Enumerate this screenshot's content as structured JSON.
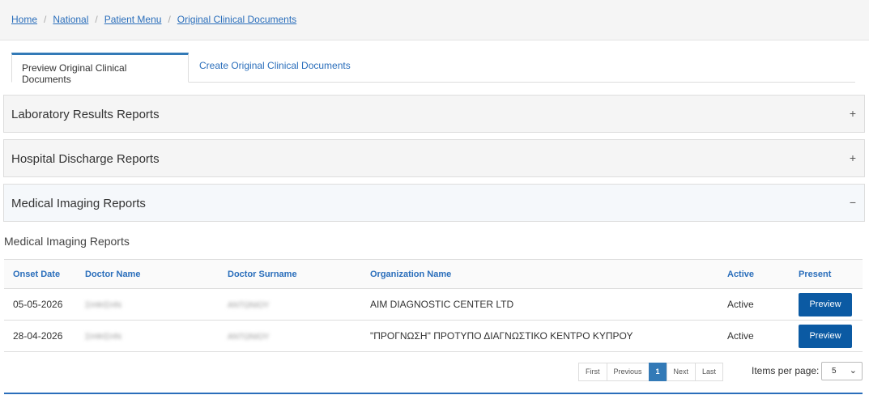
{
  "breadcrumb": [
    "Home",
    "National",
    "Patient Menu",
    "Original Clinical Documents"
  ],
  "tabs": {
    "preview": "Preview Original Clinical Documents",
    "create": "Create Original Clinical Documents"
  },
  "panels": {
    "laboratory": {
      "title": "Laboratory Results Reports",
      "marker": "+"
    },
    "discharge": {
      "title": "Hospital Discharge Reports",
      "marker": "+"
    },
    "imaging": {
      "title": "Medical Imaging Reports",
      "marker": "−"
    }
  },
  "section_title": "Medical Imaging Reports",
  "table": {
    "headers": [
      "Onset Date",
      "Doctor Name",
      "Doctor Surname",
      "Organization Name",
      "Active",
      "Present"
    ],
    "rows": [
      {
        "date": "05-05-2026",
        "name": "ΣΗΦΙΣΗΝ",
        "surname": "ΑΝΤΩΝΙΟΥ",
        "org": "AIM DIAGNOSTIC CENTER LTD",
        "active": "Active",
        "action": "Preview"
      },
      {
        "date": "28-04-2026",
        "name": "ΣΗΦΙΣΗΝ",
        "surname": "ΑΝΤΩΝΙΟΥ",
        "org": "\"ΠΡΟΓΝΩΣΗ\" ΠΡΟΤΥΠΟ ΔΙΑΓΝΩΣΤΙΚΟ ΚΕΝΤΡΟ ΚΥΠΡΟΥ",
        "active": "Active",
        "action": "Preview"
      }
    ]
  },
  "pager": {
    "first": "First",
    "previous": "Previous",
    "current": "1",
    "next": "Next",
    "last": "Last"
  },
  "items_per_page": {
    "label": "Items per page:",
    "value": "5"
  }
}
